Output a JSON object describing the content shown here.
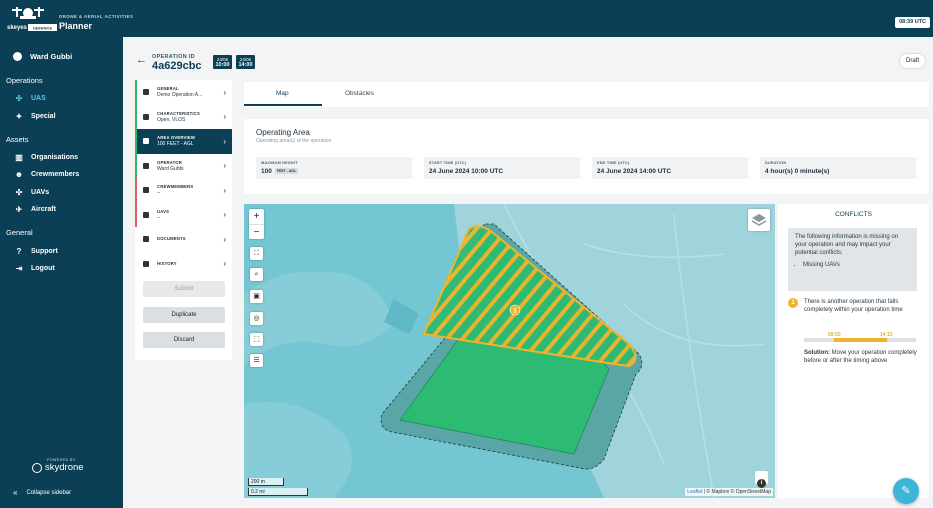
{
  "app": {
    "subtitle": "DRONE & AERIAL ACTIVITIES",
    "title": "Planner",
    "logo_text": "skeyes",
    "logo_defence": "DEFENCE",
    "clock": "08:39 UTC"
  },
  "sidebar": {
    "user_name": "Ward Gubbi",
    "operations_heading": "Operations",
    "operations_items": [
      {
        "label": "UAS",
        "icon": "drone-icon"
      },
      {
        "label": "Special",
        "icon": "sparkle-icon"
      }
    ],
    "assets_heading": "Assets",
    "assets_items": [
      {
        "label": "Organisations",
        "icon": "building-icon"
      },
      {
        "label": "Crewmembers",
        "icon": "people-icon"
      },
      {
        "label": "UAVs",
        "icon": "drone-icon"
      },
      {
        "label": "Aircraft",
        "icon": "plane-icon"
      }
    ],
    "general_heading": "General",
    "general_items": [
      {
        "label": "Support",
        "icon": "help-icon"
      },
      {
        "label": "Logout",
        "icon": "logout-icon"
      }
    ],
    "powered_by": "POWERED BY",
    "brand": "skydrone",
    "collapse_label": "Collapse sidebar"
  },
  "operation": {
    "id_label": "OPERATION ID",
    "id": "4a629cbc",
    "start_date": "24/06",
    "start_time": "10:00",
    "end_date": "24/06",
    "end_time": "14:00",
    "status": "Draft"
  },
  "steps": [
    {
      "title": "GENERAL",
      "value": "Demo Operation A...",
      "status": "green"
    },
    {
      "title": "CHARACTERISTICS",
      "value": "Open, VLOS",
      "status": "green"
    },
    {
      "title": "AREA OVERVIEW",
      "value": "100 FEET - AGL",
      "status": "active"
    },
    {
      "title": "OPERATOR",
      "value": "Ward Gubbi",
      "status": "green"
    },
    {
      "title": "CREWMEMBERS",
      "value": "--",
      "status": "red"
    },
    {
      "title": "UAVS",
      "value": "--",
      "status": "red"
    },
    {
      "title": "DOCUMENTS",
      "value": "",
      "status": "none"
    },
    {
      "title": "HISTORY",
      "value": "",
      "status": "none"
    }
  ],
  "actions": {
    "submit": "Submit",
    "duplicate": "Duplicate",
    "discard": "Discard"
  },
  "tabs": [
    "Map",
    "Obstacles"
  ],
  "area": {
    "title": "Operating Area",
    "subtitle": "Operating area(s) of the operation",
    "max_height_label": "MAXIMUM HEIGHT",
    "max_height_value": "100",
    "max_height_tag": "FEET - AGL",
    "start_label": "START TIME (UTC)",
    "start_value": "24 June 2024 10:00 UTC",
    "end_label": "END TIME (UTC)",
    "end_value": "24 June 2024 14:00 UTC",
    "duration_label": "DURATION",
    "duration_value": "4 hour(s) 0 minute(s)"
  },
  "map": {
    "scale_m": "200 m",
    "scale_mi": "0.2 mi",
    "marker_label": "1",
    "attribution_leaflet": "Leaflet",
    "attribution_rest": "| © Mapbox © OpenStreetMap",
    "colors": {
      "water": "#74c6d3",
      "land": "#9fd4dd",
      "operation": "#2dba72",
      "buffer": "#5aa6a6",
      "conflict": "#f0b429"
    }
  },
  "conflicts": {
    "title": "CONFLICTS",
    "missing_text": "The following information is missing on your operation and may impact your potential conflicts:",
    "missing_items": [
      "Missing UAVs"
    ],
    "warning_number": "1",
    "warning_text": "There is another operation that falls completely within your operation time",
    "time_start": "09:50",
    "time_end": "14:10",
    "timeline_start_fraction": 0.27,
    "timeline_end_fraction": 0.74,
    "solution_label": "Solution:",
    "solution_text": "Move your operation completely before or after the timing above"
  }
}
